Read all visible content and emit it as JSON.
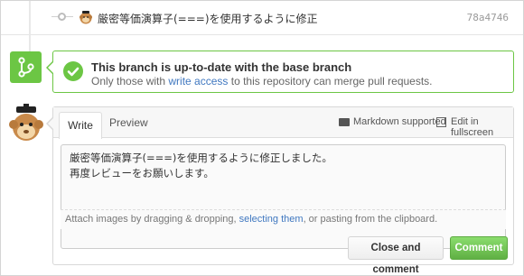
{
  "commit": {
    "message": "厳密等価演算子(===)を使用するように修正",
    "sha": "78a4746"
  },
  "merge_status": {
    "title": "This branch is up-to-date with the base branch",
    "subtitle_prefix": "Only those with ",
    "subtitle_link": "write access",
    "subtitle_suffix": " to this repository can merge pull requests.",
    "accent_color": "#6cc644"
  },
  "comment": {
    "tabs": {
      "write": "Write",
      "preview": "Preview"
    },
    "markdown_label": "Markdown supported",
    "fullscreen_label": "Edit in fullscreen",
    "body": "厳密等価演算子(===)を使用するように修正しました。\n再度レビューをお願いします。",
    "hint_prefix": "Attach images by dragging & dropping, ",
    "hint_link": "selecting them",
    "hint_suffix": ", or pasting from the clipboard.",
    "close_button": "Close and comment",
    "comment_button": "Comment"
  },
  "icons": {
    "commit": "commit-node-icon",
    "merge": "git-branch-icon",
    "check": "check-icon",
    "markdown": "markdown-icon",
    "fullscreen": "fullscreen-icon"
  }
}
